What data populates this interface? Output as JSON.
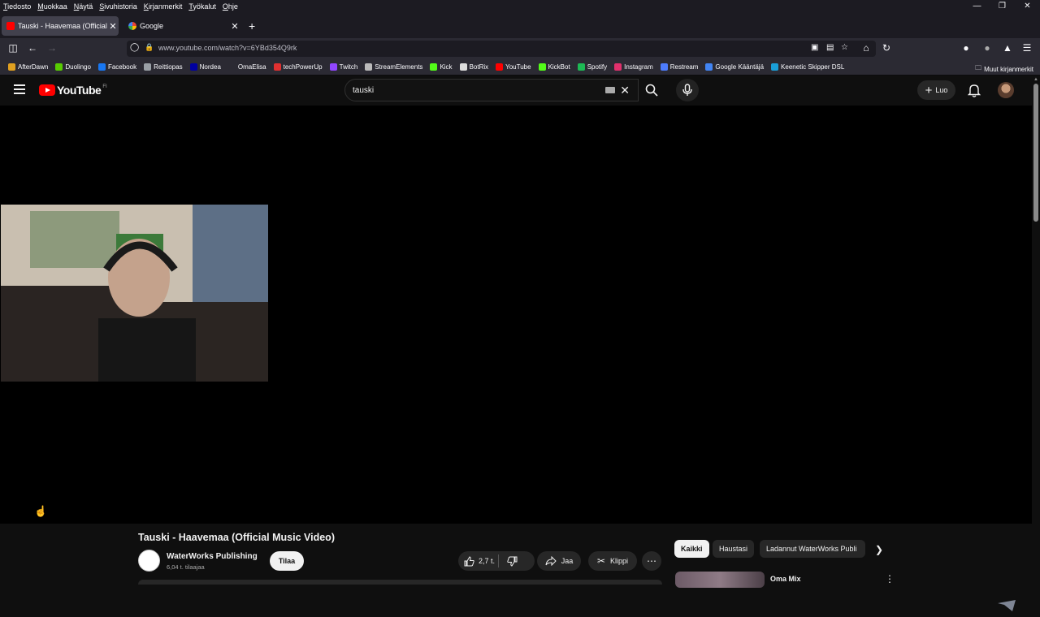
{
  "browser": {
    "menu": [
      "Tiedosto",
      "Muokkaa",
      "Näytä",
      "Sivuhistoria",
      "Kirjanmerkit",
      "Työkalut",
      "Ohje"
    ],
    "tabs": [
      {
        "title": "Tauski - Haavemaa (Official Mu",
        "icon": "youtube-favicon",
        "active": true
      },
      {
        "title": "Google",
        "icon": "google-favicon",
        "active": false
      }
    ],
    "url": "www.youtube.com/watch?v=6YBd354Q9rk",
    "bookmarks": [
      {
        "label": "AfterDawn",
        "color": "#e0a020"
      },
      {
        "label": "Duolingo",
        "color": "#58cc02"
      },
      {
        "label": "Facebook",
        "color": "#1877f2"
      },
      {
        "label": "Reittiopas",
        "color": "#9aa0a6"
      },
      {
        "label": "Nordea",
        "color": "#0000a0"
      },
      {
        "label": "OmaElisa",
        "color": "#2b2a33"
      },
      {
        "label": "techPowerUp",
        "color": "#e03030"
      },
      {
        "label": "Twitch",
        "color": "#9146ff"
      },
      {
        "label": "StreamElements",
        "color": "#bbbbbb"
      },
      {
        "label": "Kick",
        "color": "#53fc18"
      },
      {
        "label": "BotRix",
        "color": "#dddddd"
      },
      {
        "label": "YouTube",
        "color": "#ff0000"
      },
      {
        "label": "KickBot",
        "color": "#53fc18"
      },
      {
        "label": "Spotify",
        "color": "#1db954"
      },
      {
        "label": "Instagram",
        "color": "#e1306c"
      },
      {
        "label": "Restream",
        "color": "#4d7cfe"
      },
      {
        "label": "Google Kääntäjä",
        "color": "#4285f4"
      },
      {
        "label": "Keenetic Skipper DSL",
        "color": "#1a9fd8"
      }
    ],
    "other_bookmarks": "Muut kirjanmerkit"
  },
  "youtube": {
    "logo_text": "YouTube",
    "country": "FI",
    "search_value": "tauski",
    "create_label": "Luo",
    "video": {
      "title": "Tauski - Haavemaa (Official Music Video)",
      "channel": "WaterWorks Publishing",
      "subscribers": "6,04 t. tilaajaa",
      "subscribe_label": "Tilaa",
      "likes": "2,7 t.",
      "share_label": "Jaa",
      "clip_label": "Klippi"
    },
    "chips": [
      "Kaikki",
      "Haustasi",
      "Ladannut WaterWorks Publi"
    ],
    "recommendation": {
      "title": "Oma Mix"
    }
  }
}
